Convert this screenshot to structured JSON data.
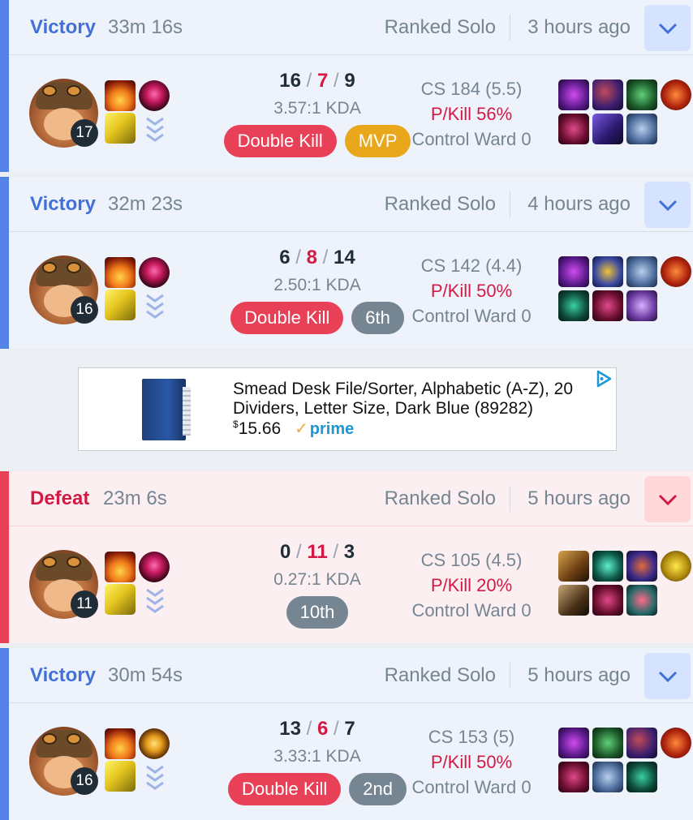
{
  "matches": [
    {
      "result": "Victory",
      "duration": "33m 16s",
      "queue": "Ranked Solo",
      "time_ago": "3 hours ago",
      "level": "17",
      "kills": "16",
      "deaths": "7",
      "assists": "9",
      "kda_ratio": "3.57:1 KDA",
      "badges": [
        "Double Kill",
        "MVP"
      ],
      "cs": "CS 184 (5.5)",
      "pkill": "P/Kill 56%",
      "control_ward": "Control Ward 0"
    },
    {
      "result": "Victory",
      "duration": "32m 23s",
      "queue": "Ranked Solo",
      "time_ago": "4 hours ago",
      "level": "16",
      "kills": "6",
      "deaths": "8",
      "assists": "14",
      "kda_ratio": "2.50:1 KDA",
      "badges": [
        "Double Kill",
        "6th"
      ],
      "cs": "CS 142 (4.4)",
      "pkill": "P/Kill 50%",
      "control_ward": "Control Ward 0"
    },
    {
      "result": "Defeat",
      "duration": "23m 6s",
      "queue": "Ranked Solo",
      "time_ago": "5 hours ago",
      "level": "11",
      "kills": "0",
      "deaths": "11",
      "assists": "3",
      "kda_ratio": "0.27:1 KDA",
      "badges": [
        "10th"
      ],
      "cs": "CS 105 (4.5)",
      "pkill": "P/Kill 20%",
      "control_ward": "Control Ward 0"
    },
    {
      "result": "Victory",
      "duration": "30m 54s",
      "queue": "Ranked Solo",
      "time_ago": "5 hours ago",
      "level": "16",
      "kills": "13",
      "deaths": "6",
      "assists": "7",
      "kda_ratio": "3.33:1 KDA",
      "badges": [
        "Double Kill",
        "2nd"
      ],
      "cs": "CS 153 (5)",
      "pkill": "P/Kill 50%",
      "control_ward": "Control Ward 0"
    }
  ],
  "kda_separator": "/",
  "ad": {
    "title": "Smead Desk File/Sorter, Alphabetic (A-Z), 20 Dividers, Letter Size, Dark Blue (89282)",
    "price_currency": "$",
    "price_value": "15.66",
    "prime_label": "prime"
  },
  "colors": {
    "win": "#5383e8",
    "loss": "#e84057",
    "mvp": "#e9a81c",
    "rank_badge": "#758592"
  }
}
